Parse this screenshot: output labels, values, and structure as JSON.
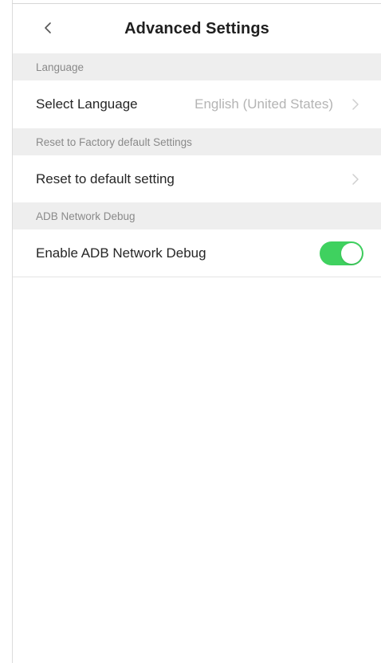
{
  "header": {
    "title": "Advanced Settings",
    "back_icon": "chevron-left-icon"
  },
  "sections": [
    {
      "header": "Language",
      "row": {
        "label": "Select Language",
        "value": "English (United States)",
        "trailing_icon": "chevron-right-icon"
      }
    },
    {
      "header": "Reset to Factory default Settings",
      "row": {
        "label": "Reset to default setting",
        "trailing_icon": "chevron-right-icon"
      }
    },
    {
      "header": "ADB Network Debug",
      "row": {
        "label": "Enable ADB Network Debug",
        "toggle_on": true
      }
    }
  ],
  "colors": {
    "toggle_on": "#3fd15f",
    "section_bg": "#eeeeee",
    "value_text": "#b4b4b4"
  }
}
